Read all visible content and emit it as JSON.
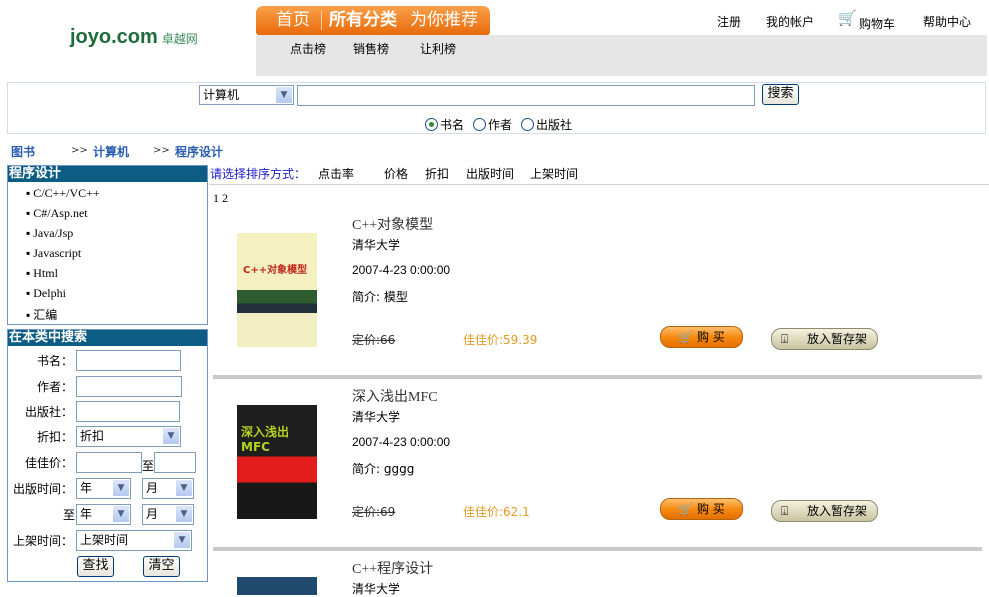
{
  "logo": {
    "text": "joyo.com",
    "cn": "卓越网"
  },
  "nav": {
    "tabs": [
      "首页",
      "所有分类",
      "为你推荐"
    ],
    "sub": [
      "点击榜",
      "销售榜",
      "让利榜"
    ]
  },
  "toplinks": {
    "register": "注册",
    "account": "我的帐户",
    "cart": "购物车",
    "help": "帮助中心"
  },
  "search": {
    "category": "计算机",
    "value": "",
    "button": "搜索",
    "options": [
      "书名",
      "作者",
      "出版社"
    ],
    "selected": "书名"
  },
  "breadcrumb": [
    "图书",
    ">>",
    "计算机",
    ">>",
    "程序设计"
  ],
  "categories": {
    "title": "程序设计",
    "items": [
      "C/C++/VC++",
      "C#/Asp.net",
      "Java/Jsp",
      "Javascript",
      "Html",
      "Delphi",
      "汇编"
    ]
  },
  "filter": {
    "title": "在本类中搜索",
    "name": "书名：",
    "author": "作者：",
    "publisher": "出版社：",
    "discount": "折扣：",
    "discount_value": "折扣",
    "price": "佳佳价：",
    "to": "至",
    "pubtime": "出版时间：",
    "year": "年",
    "month": "月",
    "shelftime": "上架时间：",
    "shelftime_value": "上架时间",
    "find": "查找",
    "clear": "清空"
  },
  "sort": {
    "label": "请选择排序方式：",
    "options": [
      "点击率",
      "价格",
      "折扣",
      "出版时间",
      "上架时间"
    ]
  },
  "pages": "1 2",
  "books": [
    {
      "title": "C++对象模型",
      "publisher": "清华大学",
      "date": "2007-4-23 0:00:00",
      "summary": "简介: 模型",
      "list_price": "定价:66",
      "price": "佳佳价:59.39",
      "cover": "C++对象模型"
    },
    {
      "title": "深入浅出MFC",
      "publisher": "清华大学",
      "date": "2007-4-23 0:00:00",
      "summary": "简介: gggg",
      "list_price": "定价:69",
      "price": "佳佳价:62.1",
      "cover": "深入浅出 MFC"
    },
    {
      "title": "C++程序设计",
      "publisher": "清华大学"
    }
  ],
  "buttons": {
    "buy": "购 买",
    "shelf": "放入暂存架"
  }
}
